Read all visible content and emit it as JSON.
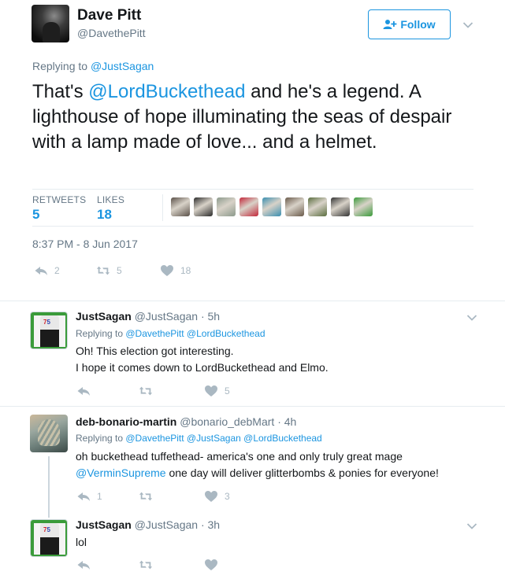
{
  "main_tweet": {
    "author_name": "Dave Pitt",
    "author_handle": "@DavethePitt",
    "follow_label": "Follow",
    "replying_prefix": "Replying to ",
    "replying_handle": "@JustSagan",
    "text_prefix": "That's ",
    "text_mention": "@LordBuckethead",
    "text_rest": " and he's a legend. A lighthouse of hope illuminating the seas of despair with a lamp made of love... and a helmet.",
    "retweets_label": "RETWEETS",
    "retweets_count": "5",
    "likes_label": "LIKES",
    "likes_count": "18",
    "timestamp": "8:37 PM - 8 Jun 2017",
    "reply_count": "2",
    "retweet_action_count": "5",
    "like_action_count": "18",
    "liker_colors": [
      "#5a5048",
      "#2b2b2b",
      "#8c9a8c",
      "#c3283a",
      "#3a8fb0",
      "#6a5a4a",
      "#5b6e3f",
      "#333333",
      "#3a9b3a"
    ]
  },
  "replies": [
    {
      "name": "JustSagan",
      "handle": "@JustSagan",
      "time": "· 5h",
      "replying_prefix": "Replying to ",
      "replying_handles": "@DavethePitt @LordBuckethead",
      "text_line1": "Oh! This election got interesting.",
      "text_line2": "I hope it comes down to LordBuckethead and Elmo.",
      "reply_count": "",
      "retweet_count": "",
      "like_count": "5"
    },
    {
      "name": "deb-bonario-martin",
      "handle": "@bonario_debMart",
      "time": "· 4h",
      "replying_prefix": "Replying to ",
      "replying_handles": "@DavethePitt @JustSagan @LordBuckethead",
      "text_line1": "oh buckethead tuffethead- america's one and only truly great mage",
      "text_mention": "@VerminSupreme",
      "text_line2_rest": " one day will deliver glitterbombs & ponies for everyone!",
      "reply_count": "1",
      "retweet_count": "",
      "like_count": "3"
    },
    {
      "name": "JustSagan",
      "handle": "@JustSagan",
      "time": "· 3h",
      "text_line1": "lol",
      "reply_count": "",
      "retweet_count": "",
      "like_count": ""
    }
  ],
  "icons": {
    "reply": "reply-arrow-icon",
    "retweet": "retweet-icon",
    "like": "heart-icon",
    "caret": "chevron-down-icon",
    "follow": "add-user-icon"
  },
  "colors": {
    "link": "#1b95e0",
    "muted": "#657786",
    "action": "#aab8c2"
  }
}
